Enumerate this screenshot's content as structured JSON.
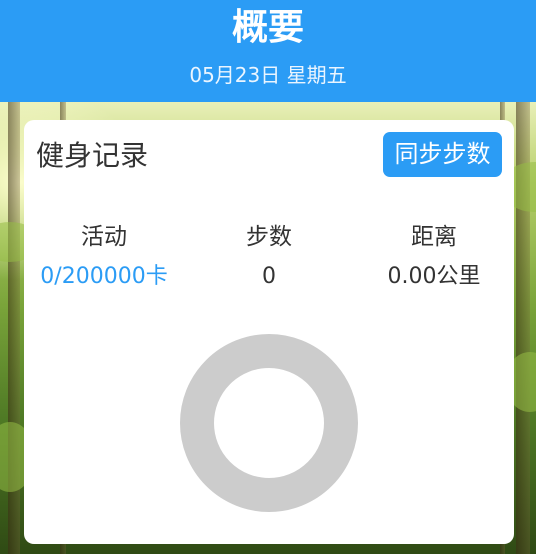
{
  "header": {
    "title": "概要",
    "date": "05月23日 星期五"
  },
  "card": {
    "title": "健身记录",
    "sync_button": "同步步数",
    "stats": [
      {
        "label": "活动",
        "value": "0/200000卡"
      },
      {
        "label": "步数",
        "value": "0"
      },
      {
        "label": "距离",
        "value": "0.00公里"
      }
    ],
    "progress": 0
  },
  "colors": {
    "accent": "#2b9cf5",
    "ring_track": "#cccccc",
    "text": "#333333",
    "card_bg": "#ffffff"
  }
}
